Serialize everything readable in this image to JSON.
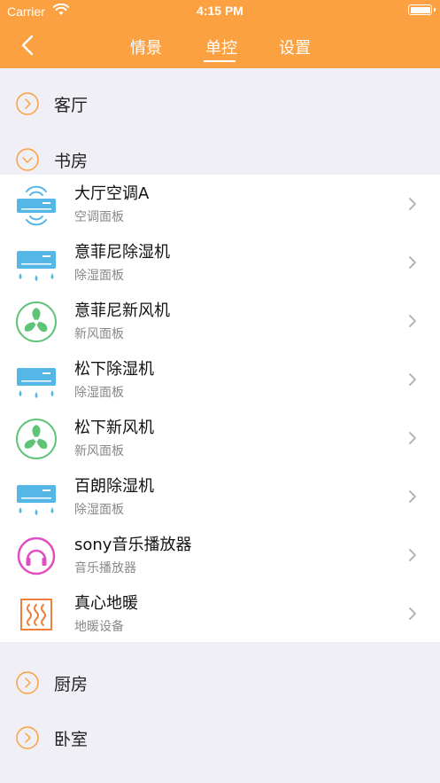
{
  "status_bar": {
    "carrier": "Carrier",
    "time": "4:15 PM"
  },
  "header": {
    "back_icon": "chevron-left-icon",
    "tabs": [
      {
        "label": "情景"
      },
      {
        "label": "单控"
      },
      {
        "label": "设置"
      }
    ],
    "active_tab": "单控",
    "background": "#fba142"
  },
  "groups": [
    {
      "label": "客厅",
      "expanded": false
    },
    {
      "label": "书房",
      "expanded": true
    },
    {
      "label": "厨房",
      "expanded": false
    },
    {
      "label": "卧室",
      "expanded": false
    }
  ],
  "devices": [
    {
      "name": "大厅空调A",
      "type": "空调面板",
      "icon": "air-conditioner-icon"
    },
    {
      "name": "意菲尼除湿机",
      "type": "除湿面板",
      "icon": "dehumidifier-icon"
    },
    {
      "name": "意菲尼新风机",
      "type": "新风面板",
      "icon": "fan-icon"
    },
    {
      "name": "松下除湿机",
      "type": "除湿面板",
      "icon": "dehumidifier-icon"
    },
    {
      "name": "松下新风机",
      "type": "新风面板",
      "icon": "fan-icon"
    },
    {
      "name": "百朗除湿机",
      "type": "除湿面板",
      "icon": "dehumidifier-icon"
    },
    {
      "name": "sony音乐播放器",
      "type": "音乐播放器",
      "icon": "headphones-icon"
    },
    {
      "name": "真心地暖",
      "type": "地暖设备",
      "icon": "floor-heating-icon"
    }
  ],
  "colors": {
    "accent": "#fba142",
    "ac_blue": "#55b6e8",
    "fan_green": "#5fc477",
    "music_pink": "#e04fbf",
    "heat_orange": "#ee7f3d"
  }
}
